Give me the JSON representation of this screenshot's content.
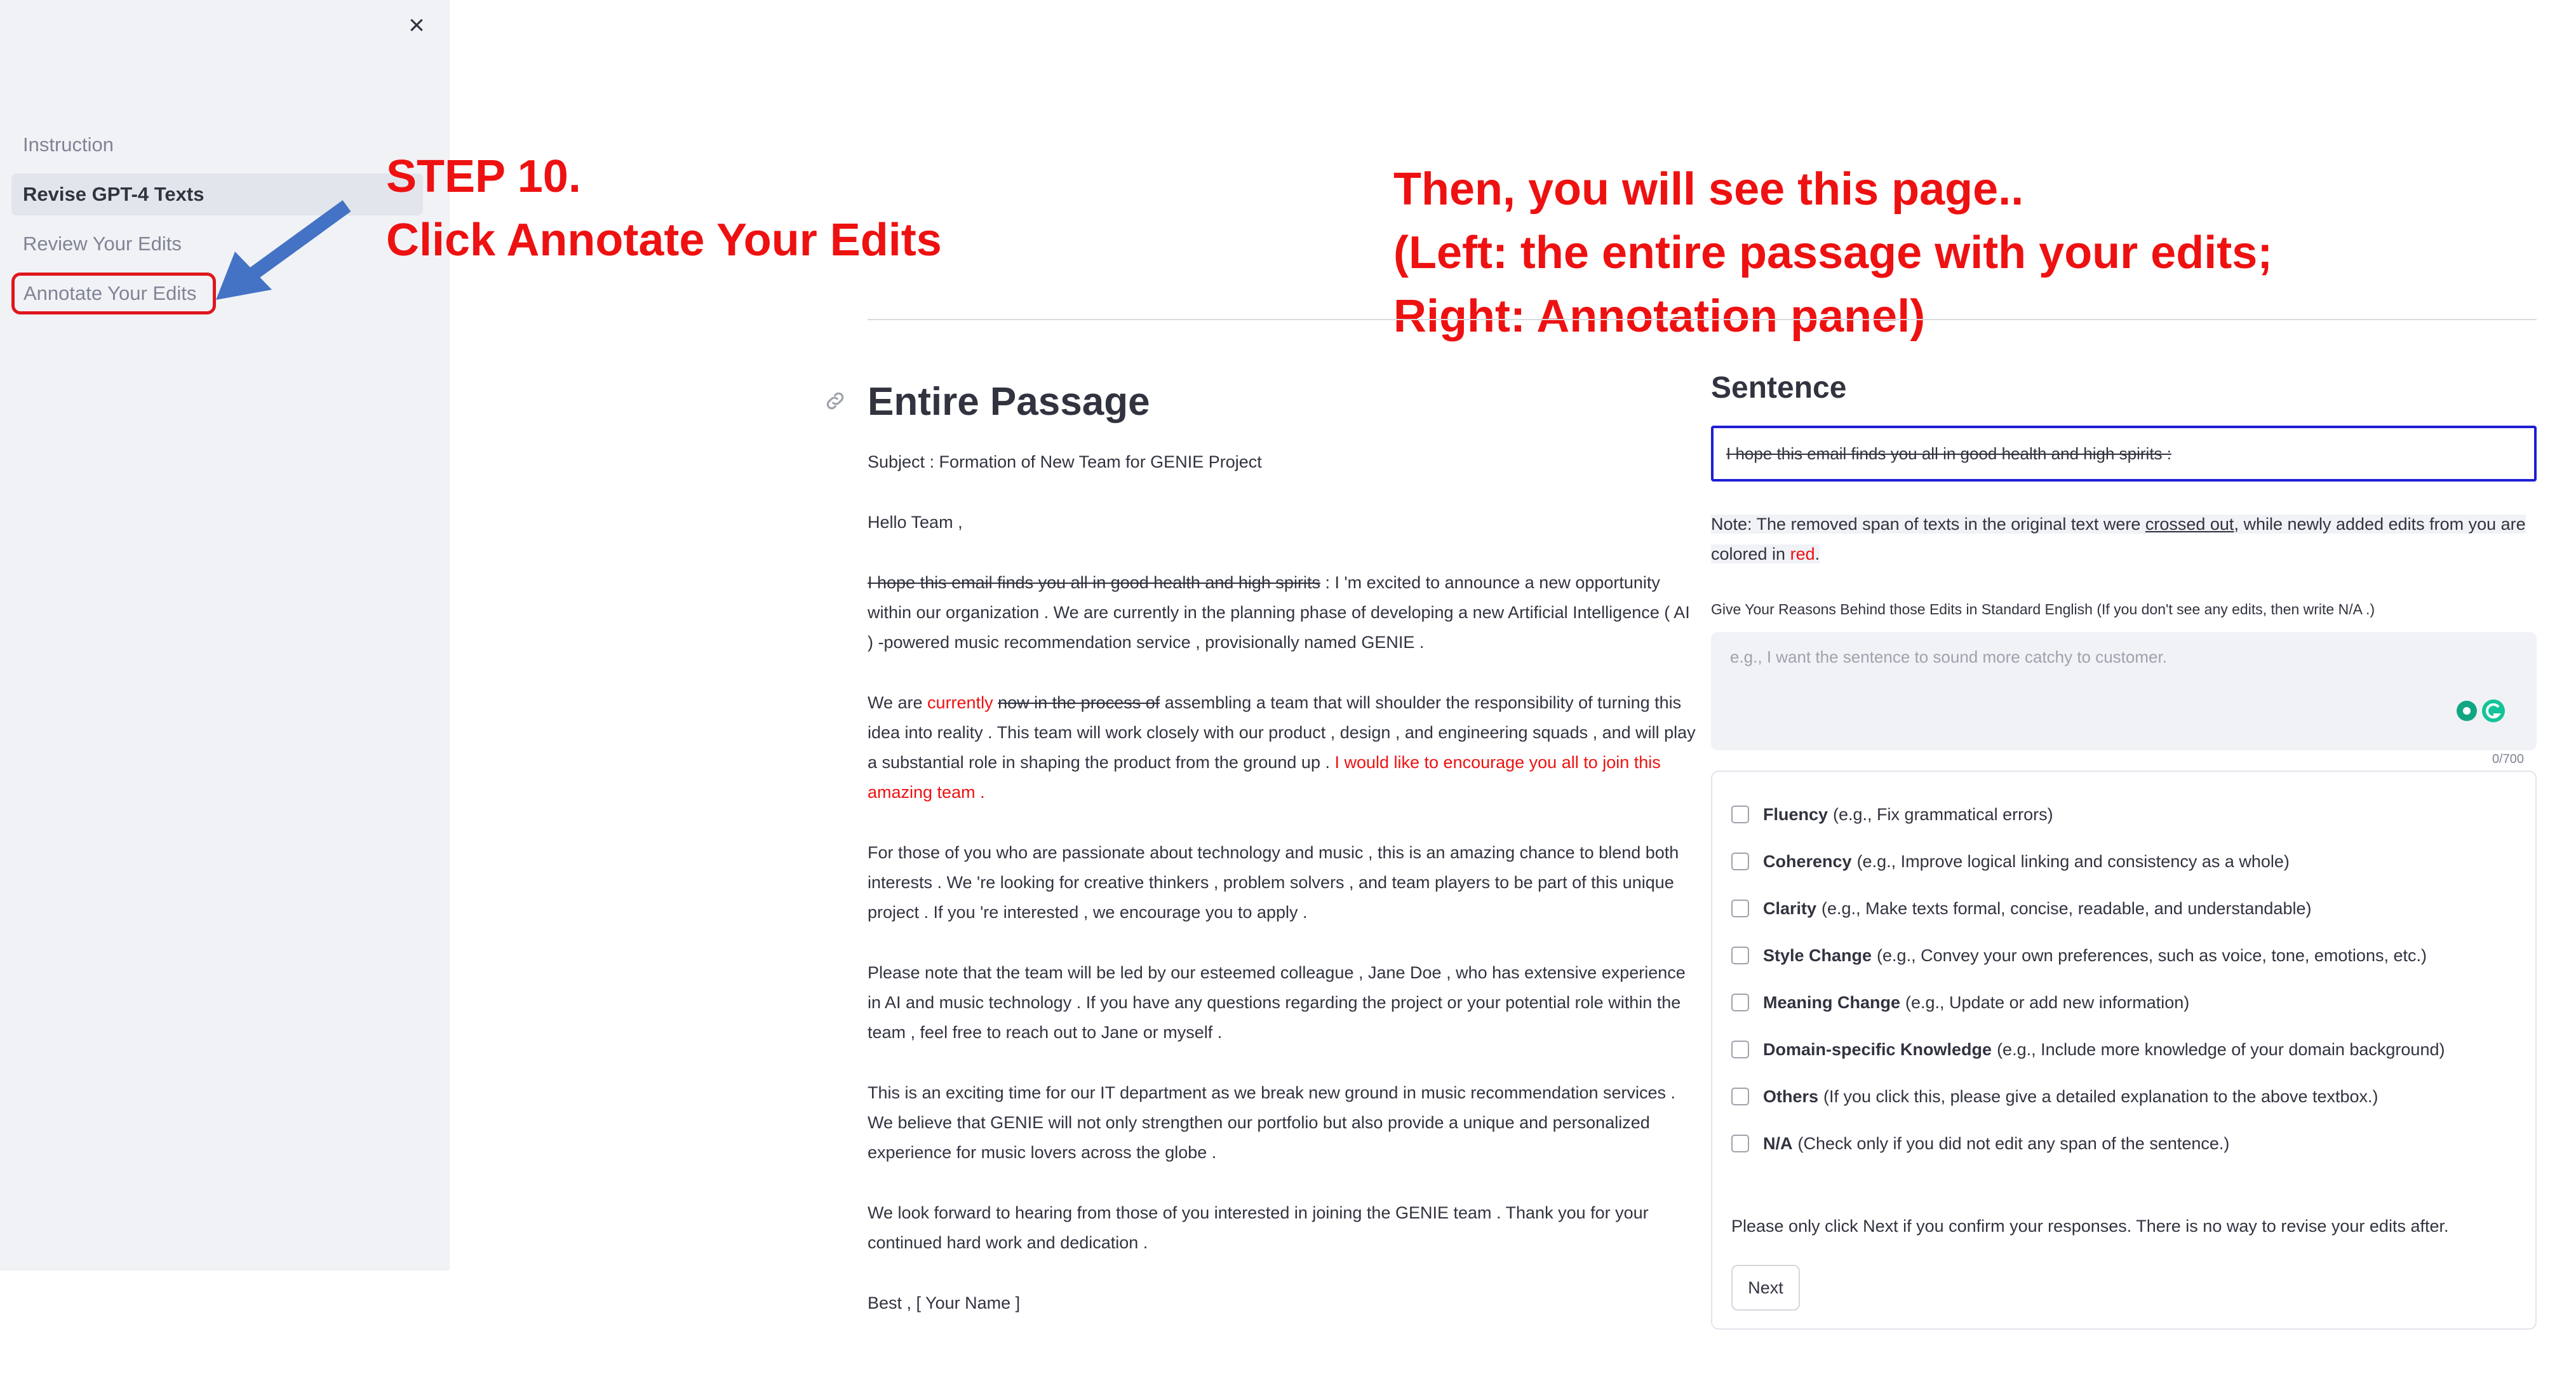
{
  "sidebar": {
    "close_glyph": "×",
    "items": [
      {
        "label": "Instruction"
      },
      {
        "label": "Revise GPT-4 Texts"
      },
      {
        "label": "Review Your Edits"
      },
      {
        "label": "Annotate Your Edits"
      }
    ]
  },
  "annotations": {
    "step_line1": "STEP 10.",
    "step_line2": "Click Annotate Your Edits",
    "then_line1": "Then, you will see this page..",
    "then_line2": "(Left: the entire passage with your edits;",
    "then_line3": "Right: Annotation panel)",
    "annotation_color": "#ee1111",
    "arrow_color": "#4472c4"
  },
  "passage": {
    "title": "Entire Passage",
    "subject": "Subject : Formation of New Team for GENIE Project",
    "greeting": "Hello Team ,",
    "p1_del": "I hope this email finds you all in good health and high spirits",
    "p1_rest": " : I 'm excited to announce a new opportunity within our organization . We are currently in the planning phase of developing a new Artificial Intelligence ( AI ) -powered music recommendation service , provisionally named GENIE .",
    "p2_a": "We are ",
    "p2_add1": "currently",
    "p2_b": " ",
    "p2_del1": "now in the process of",
    "p2_c": " assembling a team that will shoulder the responsibility of turning this idea into reality . This team will work closely with our product , design , and engineering squads , and will play a substantial role in shaping the product from the ground up . ",
    "p2_add2": "I would like to encourage you all to join this amazing team .",
    "p3": "For those of you who are passionate about technology and music , this is an amazing chance to blend both interests . We 're looking for creative thinkers , problem solvers , and team players to be part of this unique project . If you 're interested , we encourage you to apply .",
    "p4": "Please note that the team will be led by our esteemed colleague , Jane Doe , who has extensive experience in AI and music technology . If you have any questions regarding the project or your potential role within the team , feel free to reach out to Jane or myself .",
    "p5": "This is an exciting time for our IT department as we break new ground in music recommendation services . We believe that GENIE will not only strengthen our portfolio but also provide a unique and personalized experience for music lovers across the globe .",
    "p6": "We look forward to hearing from those of you interested in joining the GENIE team . Thank you for your continued hard work and dedication .",
    "signoff": "Best , [ Your Name ]"
  },
  "sentence_panel": {
    "title": "Sentence",
    "sentence_del": "I hope this email finds you all in good health and high spirits :",
    "note_a": "Note: The removed span of texts in the original text were ",
    "note_u": "crossed out",
    "note_b": ", while newly added edits from you are colored in ",
    "note_red": "red",
    "note_c": ".",
    "reason_label": "Give Your Reasons Behind those Edits in Standard English (If you don't see any edits, then write N/A .)",
    "reason_placeholder": "e.g., I want the sentence to sound more catchy to customer.",
    "char_counter": "0/700",
    "options": [
      {
        "name": "Fluency",
        "desc": "(e.g., Fix grammatical errors)"
      },
      {
        "name": "Coherency",
        "desc": "(e.g., Improve logical linking and consistency as a whole)"
      },
      {
        "name": "Clarity",
        "desc": "(e.g., Make texts formal, concise, readable, and understandable)"
      },
      {
        "name": "Style Change",
        "desc": "(e.g., Convey your own preferences, such as voice, tone, emotions, etc.)"
      },
      {
        "name": "Meaning Change",
        "desc": "(e.g., Update or add new information)"
      },
      {
        "name": "Domain-specific Knowledge",
        "desc": "(e.g., Include more knowledge of your domain background)"
      },
      {
        "name": "Others",
        "desc": "(If you click this, please give a detailed explanation to the above textbox.)"
      },
      {
        "name": "N/A",
        "desc": "(Check only if you did not edit any span of the sentence.)"
      }
    ],
    "confirm_text": "Please only click Next if you confirm your responses. There is no way to revise your edits after.",
    "next_label": "Next"
  }
}
